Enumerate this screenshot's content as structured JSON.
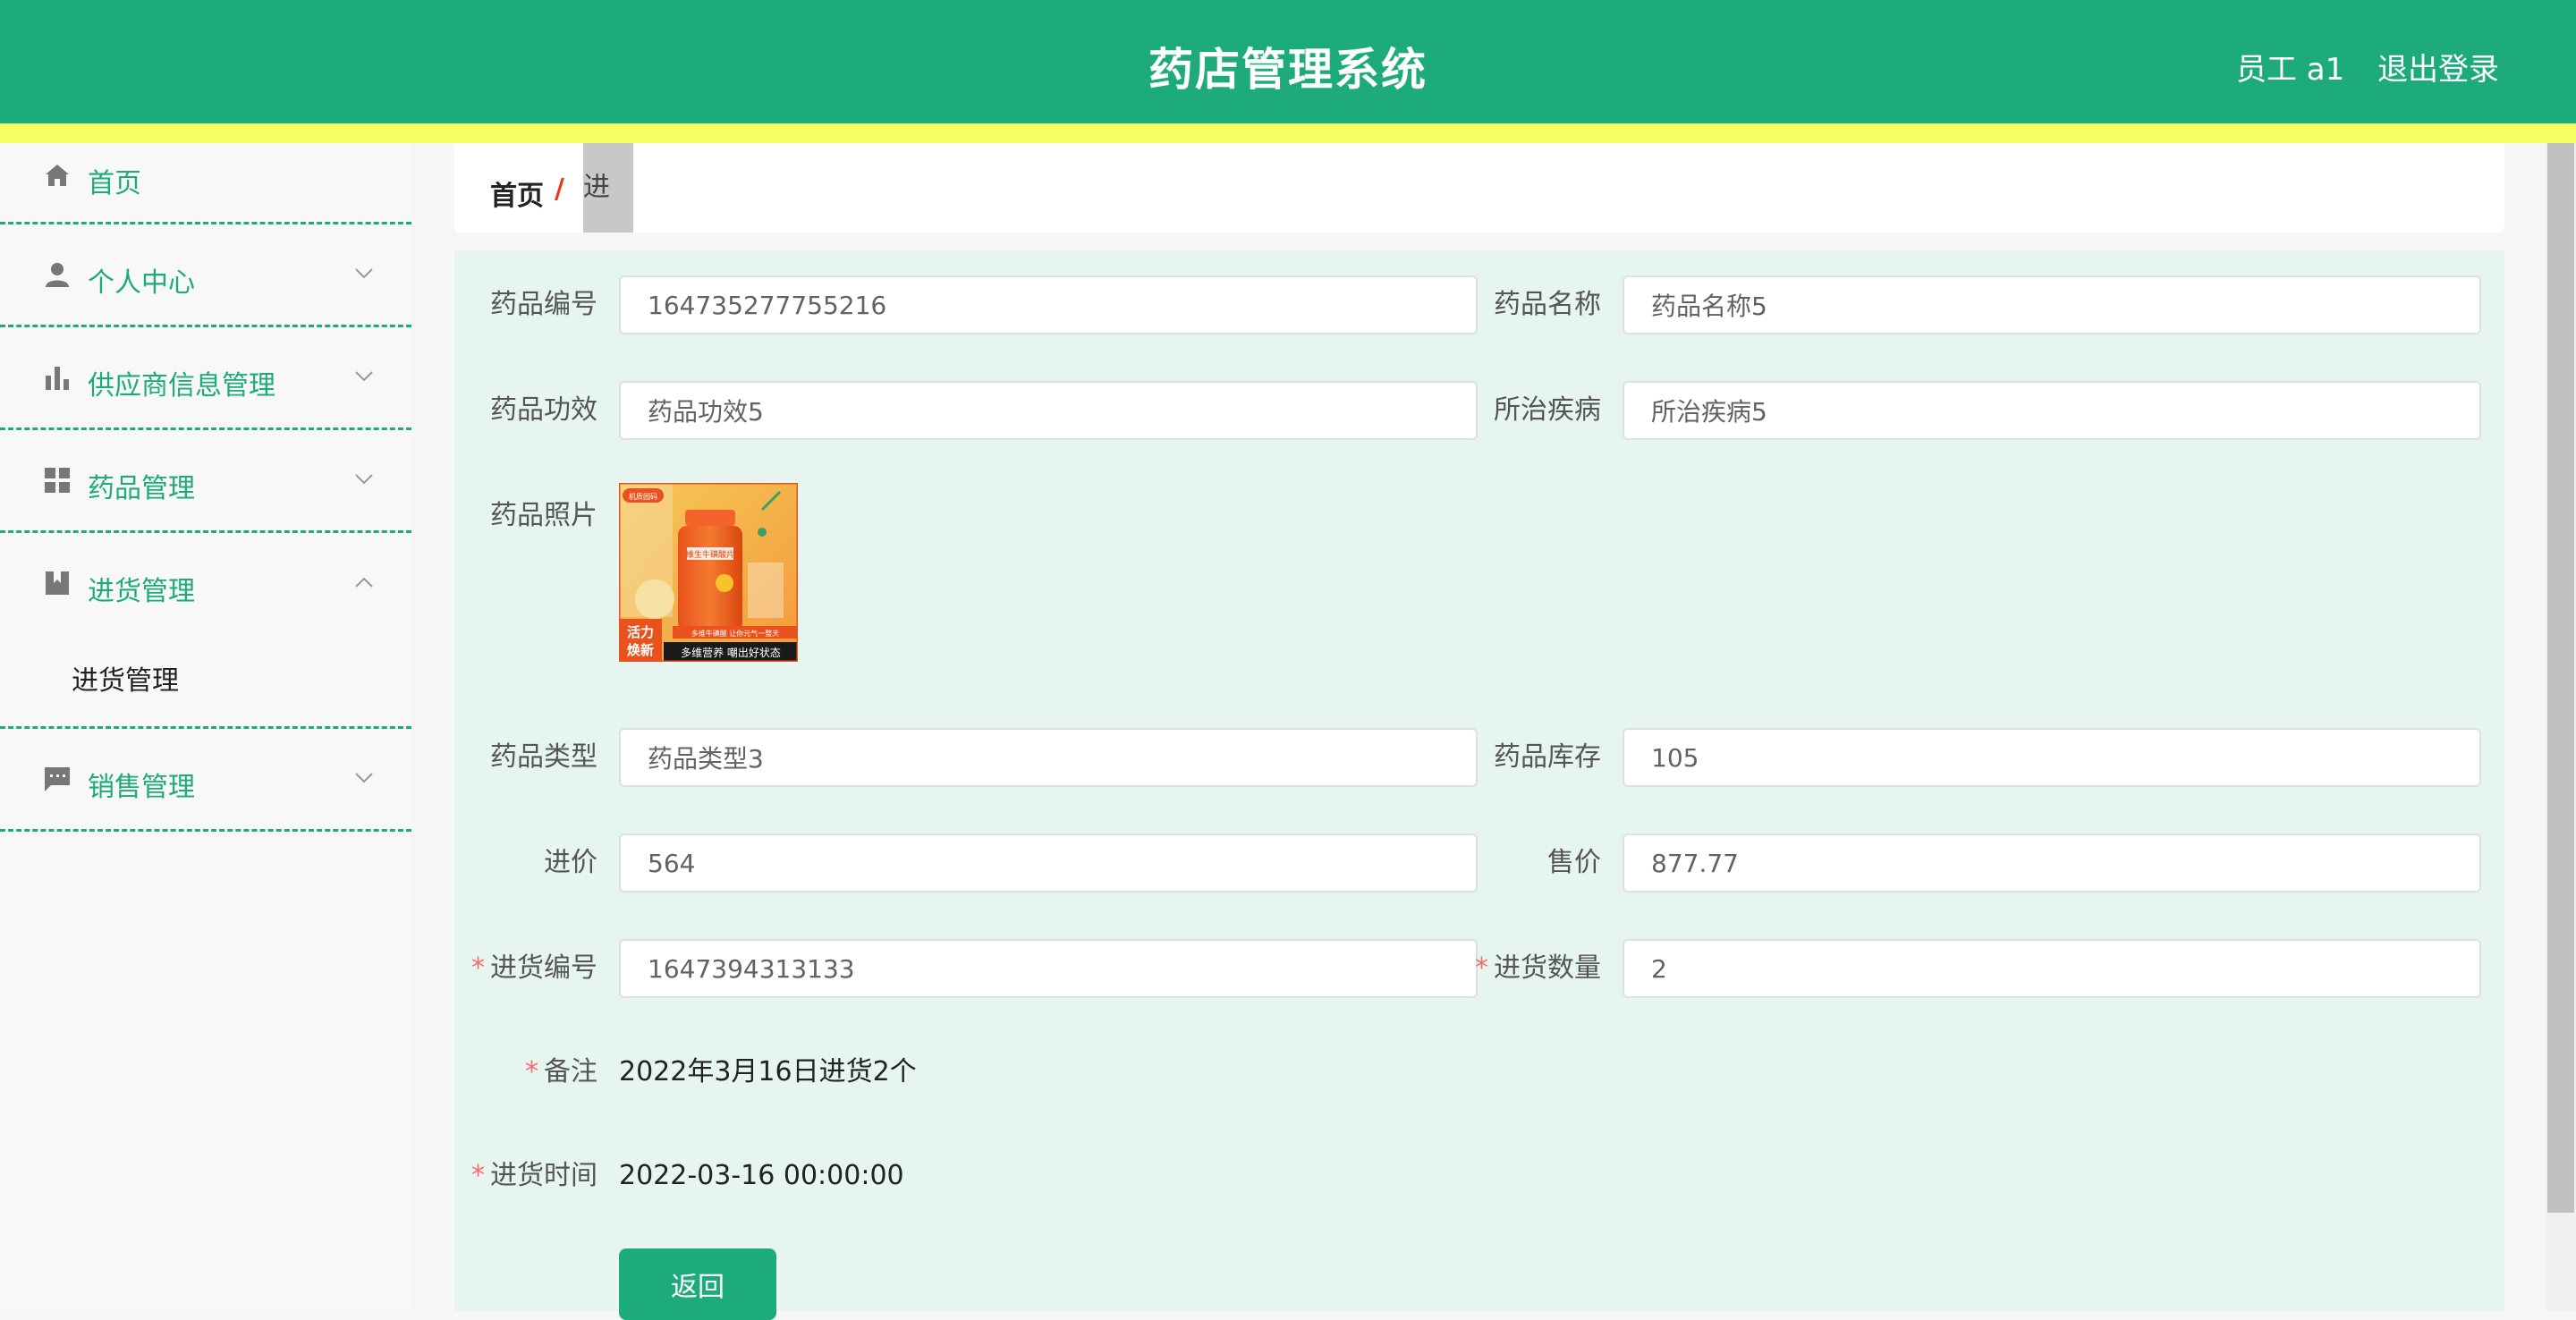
{
  "header": {
    "title": "药店管理系统",
    "user": "员工 a1",
    "logout": "退出登录",
    "bg_color": "#1eab7c",
    "stripe_color": "#f3ff63"
  },
  "sidebar": {
    "items": [
      {
        "label": "首页",
        "icon": "home-icon"
      },
      {
        "label": "个人中心",
        "icon": "user-icon"
      },
      {
        "label": "供应商信息管理",
        "icon": "bar-chart-icon"
      },
      {
        "label": "药品管理",
        "icon": "grid-icon"
      },
      {
        "label": "进货管理",
        "icon": "book-icon",
        "expanded": true,
        "children": [
          "进货管理"
        ]
      },
      {
        "label": "销售管理",
        "icon": "chat-icon"
      }
    ]
  },
  "breadcrumb": {
    "home": "首页",
    "separator": "/",
    "current": "进货"
  },
  "form": {
    "drug_no": {
      "label": "药品编号",
      "value": "164735277755216"
    },
    "drug_name": {
      "label": "药品名称",
      "value": "药品名称5"
    },
    "efficacy": {
      "label": "药品功效",
      "value": "药品功效5"
    },
    "disease": {
      "label": "所治疾病",
      "value": "所治疾病5"
    },
    "photo": {
      "label": "药品照片",
      "tag": "机质园码",
      "bottle_label": "维生牛磺酸片",
      "slogan_left_1": "活力",
      "slogan_left_2": "焕新",
      "slogan_bottom": "多维营养 嘲出好状态",
      "slogan_small": "多维牛磺酸 让你元气一整天"
    },
    "drug_type": {
      "label": "药品类型",
      "value": "药品类型3"
    },
    "stock": {
      "label": "药品库存",
      "value": "105"
    },
    "purchase_price": {
      "label": "进价",
      "value": "564"
    },
    "sale_price": {
      "label": "售价",
      "value": "877.77"
    },
    "purchase_no": {
      "label": "进货编号",
      "value": "1647394313133",
      "required": "*"
    },
    "purchase_qty": {
      "label": "进货数量",
      "value": "2",
      "required": "*"
    },
    "remark": {
      "label": "备注",
      "value": "2022年3月16日进货2个",
      "required": "*"
    },
    "purchase_time": {
      "label": "进货时间",
      "value": "2022-03-16 00:00:00",
      "required": "*"
    },
    "back_button": "返回"
  }
}
